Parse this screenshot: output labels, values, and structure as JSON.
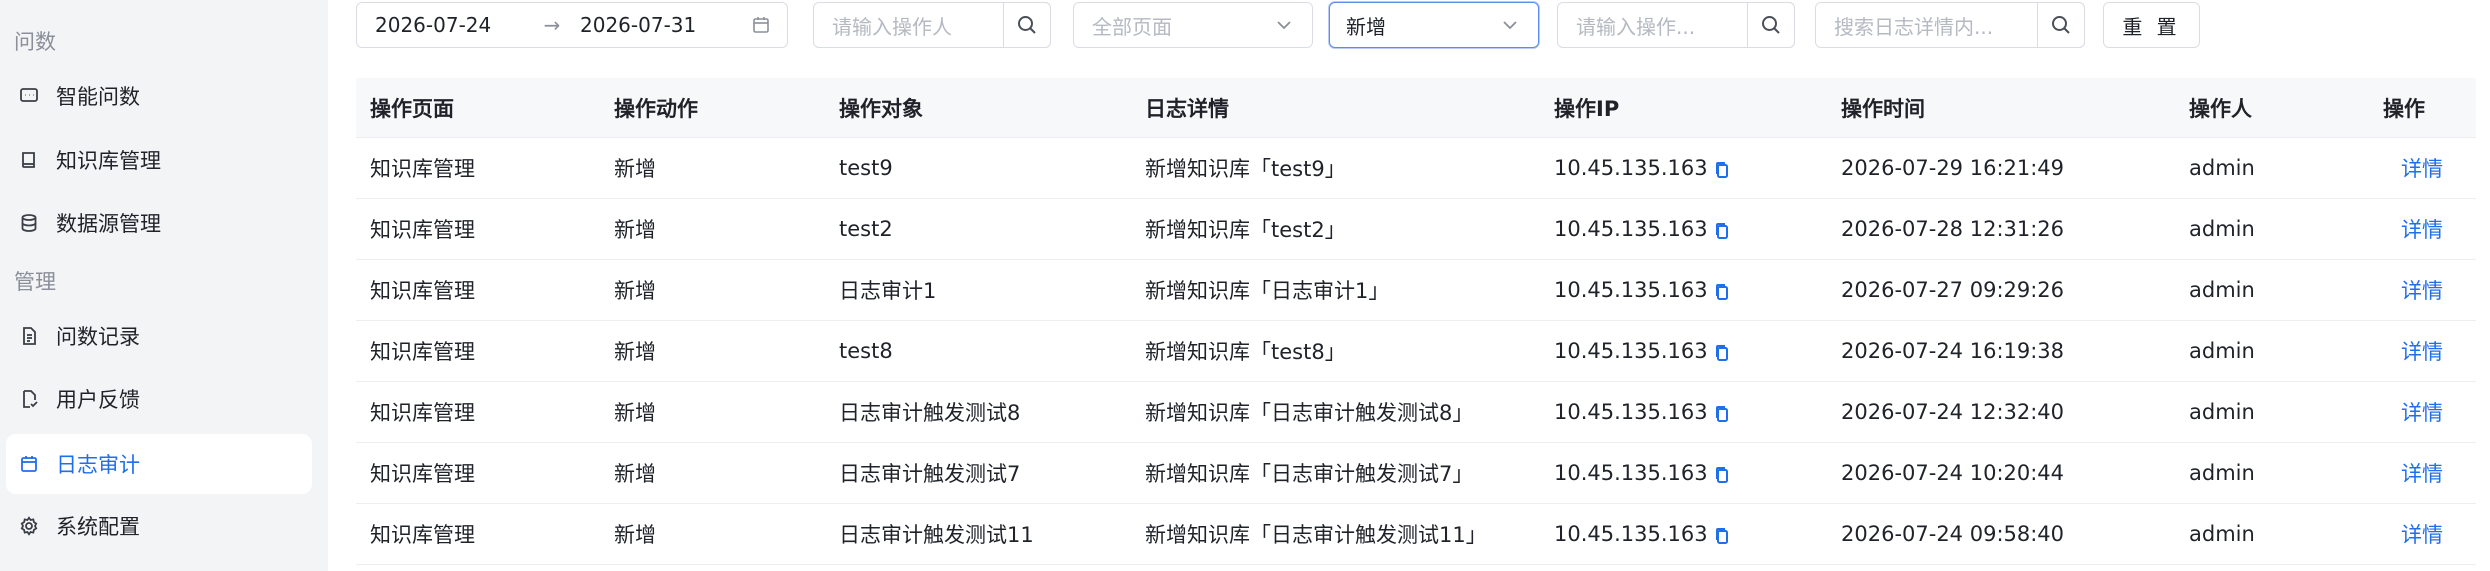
{
  "sidebar": {
    "section_1": "问数",
    "section_2": "管理",
    "items": [
      {
        "label": "智能问数",
        "icon": "chat-icon"
      },
      {
        "label": "知识库管理",
        "icon": "book-icon"
      },
      {
        "label": "数据源管理",
        "icon": "database-icon"
      },
      {
        "label": "问数记录",
        "icon": "document-icon"
      },
      {
        "label": "用户反馈",
        "icon": "feedback-icon"
      },
      {
        "label": "日志审计",
        "icon": "calendar-icon"
      },
      {
        "label": "系统配置",
        "icon": "gear-icon"
      }
    ],
    "active_color": "#1f6feb"
  },
  "filters": {
    "date_start": "2026-07-24",
    "date_end": "2026-07-31",
    "date_sep": "→",
    "operator_placeholder": "请输入操作人",
    "page_placeholder": "全部页面",
    "action_value": "新增",
    "object_placeholder": "请输入操作...",
    "detail_placeholder": "搜索日志详情内...",
    "reset_label": "重 置"
  },
  "table": {
    "columns": [
      "操作页面",
      "操作动作",
      "操作对象",
      "日志详情",
      "操作IP",
      "操作时间",
      "操作人",
      "操作"
    ],
    "rows": [
      {
        "page": "知识库管理",
        "action": "新增",
        "object": "test9",
        "detail": "新增知识库「test9」",
        "ip": "10.45.135.163",
        "time": "2026-07-29 16:21:49",
        "user": "admin",
        "op": "详情"
      },
      {
        "page": "知识库管理",
        "action": "新增",
        "object": "test2",
        "detail": "新增知识库「test2」",
        "ip": "10.45.135.163",
        "time": "2026-07-28 12:31:26",
        "user": "admin",
        "op": "详情"
      },
      {
        "page": "知识库管理",
        "action": "新增",
        "object": "日志审计1",
        "detail": "新增知识库「日志审计1」",
        "ip": "10.45.135.163",
        "time": "2026-07-27 09:29:26",
        "user": "admin",
        "op": "详情"
      },
      {
        "page": "知识库管理",
        "action": "新增",
        "object": "test8",
        "detail": "新增知识库「test8」",
        "ip": "10.45.135.163",
        "time": "2026-07-24 16:19:38",
        "user": "admin",
        "op": "详情"
      },
      {
        "page": "知识库管理",
        "action": "新增",
        "object": "日志审计触发测试8",
        "detail": "新增知识库「日志审计触发测试8」",
        "ip": "10.45.135.163",
        "time": "2026-07-24 12:32:40",
        "user": "admin",
        "op": "详情"
      },
      {
        "page": "知识库管理",
        "action": "新增",
        "object": "日志审计触发测试7",
        "detail": "新增知识库「日志审计触发测试7」",
        "ip": "10.45.135.163",
        "time": "2026-07-24 10:20:44",
        "user": "admin",
        "op": "详情"
      },
      {
        "page": "知识库管理",
        "action": "新增",
        "object": "日志审计触发测试11",
        "detail": "新增知识库「日志审计触发测试11」",
        "ip": "10.45.135.163",
        "time": "2026-07-24 09:58:40",
        "user": "admin",
        "op": "详情"
      }
    ]
  }
}
